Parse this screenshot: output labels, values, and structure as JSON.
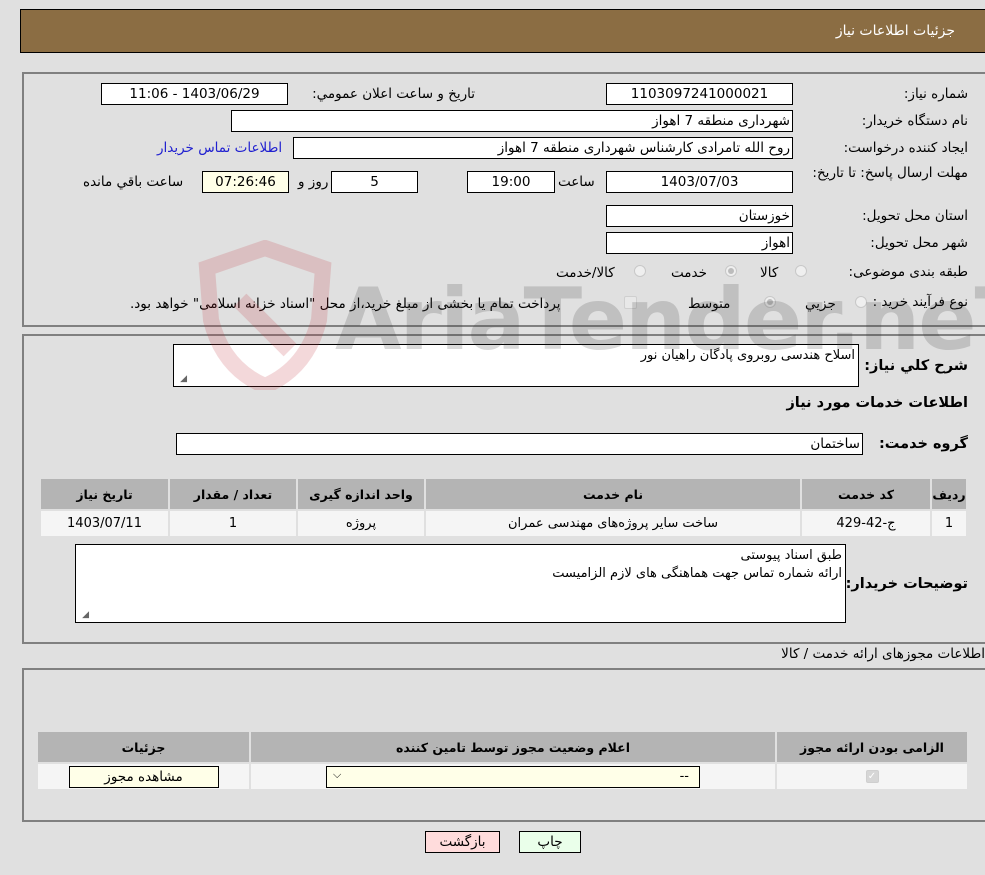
{
  "header": {
    "title": "جزئیات اطلاعات نیاز"
  },
  "form": {
    "need_number_label": "شماره نیاز:",
    "need_number": "1103097241000021",
    "announce_label": "تاریخ و ساعت اعلان عمومي:",
    "announce_value": "1403/06/29 - 11:06",
    "buyer_org_label": "نام دستگاه خریدار:",
    "buyer_org": "شهرداری منطقه 7 اهواز",
    "creator_label": "ایجاد کننده درخواست:",
    "creator": "روح الله تامرادی کارشناس شهرداری منطقه 7 اهواز",
    "contact_link": "اطلاعات تماس خریدار",
    "deadline_label": "مهلت ارسال پاسخ: تا تاریخ:",
    "deadline_date": "1403/07/03",
    "time_label": "ساعت",
    "deadline_time": "19:00",
    "days": "5",
    "days_label": "روز و",
    "remaining": "07:26:46",
    "remaining_label": "ساعت باقي مانده",
    "province_label": "استان محل تحویل:",
    "province": "خوزستان",
    "city_label": "شهر محل تحویل:",
    "city": "اهواز",
    "category_label": "طبقه بندی موضوعی:",
    "category_options": [
      {
        "label": "کالا",
        "selected": false
      },
      {
        "label": "خدمت",
        "selected": true
      },
      {
        "label": "کالا/خدمت",
        "selected": false
      }
    ],
    "process_label": "نوع فرآیند خرید :",
    "process_options": [
      {
        "label": "جزيي",
        "selected": false
      },
      {
        "label": "متوسط",
        "selected": true
      }
    ],
    "treasury_note": "پرداخت تمام یا بخشی از مبلغ خرید،از محل \"اسناد خزانه اسلامی\" خواهد بود.",
    "treasury_checked": false
  },
  "details": {
    "summary_label": "شرح کلي نیاز:",
    "summary": "اسلاح هندسی روبروی پادگان راهیان نور",
    "services_heading": "اطلاعات خدمات مورد نیاز",
    "service_group_label": "گروه خدمت:",
    "service_group": "ساختمان",
    "table": {
      "headers": [
        "ردیف",
        "کد خدمت",
        "نام خدمت",
        "واحد اندازه گیری",
        "تعداد / مقدار",
        "تاریخ نیاز"
      ],
      "rows": [
        [
          "1",
          "ج-42-429",
          "ساخت سایر پروژه‌های مهندسی عمران",
          "پروژه",
          "1",
          "1403/07/11"
        ]
      ]
    },
    "buyer_notes_label": "توضیحات خریدار:",
    "buyer_notes_line1": "طبق اسناد پیوستی",
    "buyer_notes_line2": "ارائه شماره تماس جهت هماهنگی های لازم الزامیست"
  },
  "permits": {
    "heading": "اطلاعات مجوزهای ارائه خدمت / کالا",
    "headers": [
      "الزامی بودن ارائه مجوز",
      "اعلام وضعیت مجوز توسط تامین کننده",
      "جزئیات"
    ],
    "row": {
      "required_checked": true,
      "status_value": "--",
      "view_button": "مشاهده مجوز"
    }
  },
  "buttons": {
    "print": "چاپ",
    "back": "بازگشت"
  },
  "watermark": "AriaTender.neT"
}
